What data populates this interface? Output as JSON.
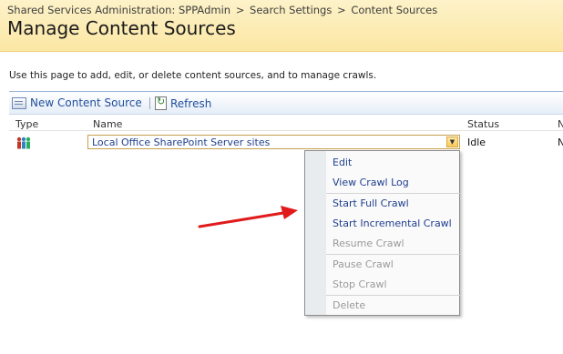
{
  "header": {
    "breadcrumb": [
      "Shared Services Administration: SPPAdmin",
      "Search Settings",
      "Content Sources"
    ],
    "breadcrumb_separator": ">",
    "title": "Manage Content Sources"
  },
  "description": "Use this page to add, edit, or delete content sources, and to manage crawls.",
  "toolbar": {
    "new_label": "New Content Source",
    "refresh_label": "Refresh",
    "separator": "|"
  },
  "table": {
    "columns": [
      "Type",
      "Name",
      "Status",
      "N"
    ],
    "rows": [
      {
        "name": "Local Office SharePoint Server sites",
        "status": "Idle",
        "next": "N",
        "type_icon": "sharepoint-sites-icon"
      }
    ]
  },
  "context_menu": {
    "items": [
      {
        "label": "Edit",
        "enabled": true
      },
      {
        "label": "View Crawl Log",
        "enabled": true
      },
      {
        "label": "Start Full Crawl",
        "enabled": true
      },
      {
        "label": "Start Incremental Crawl",
        "enabled": true
      },
      {
        "label": "Resume Crawl",
        "enabled": false
      },
      {
        "label": "Pause Crawl",
        "enabled": false
      },
      {
        "label": "Stop Crawl",
        "enabled": false
      },
      {
        "label": "Delete",
        "enabled": false
      }
    ]
  },
  "annotation": {
    "arrow_color": "#e01b1b"
  },
  "colors": {
    "header_bg": "#fbe7a4",
    "link": "#1f4e9c",
    "disabled": "#9a9a9a"
  }
}
